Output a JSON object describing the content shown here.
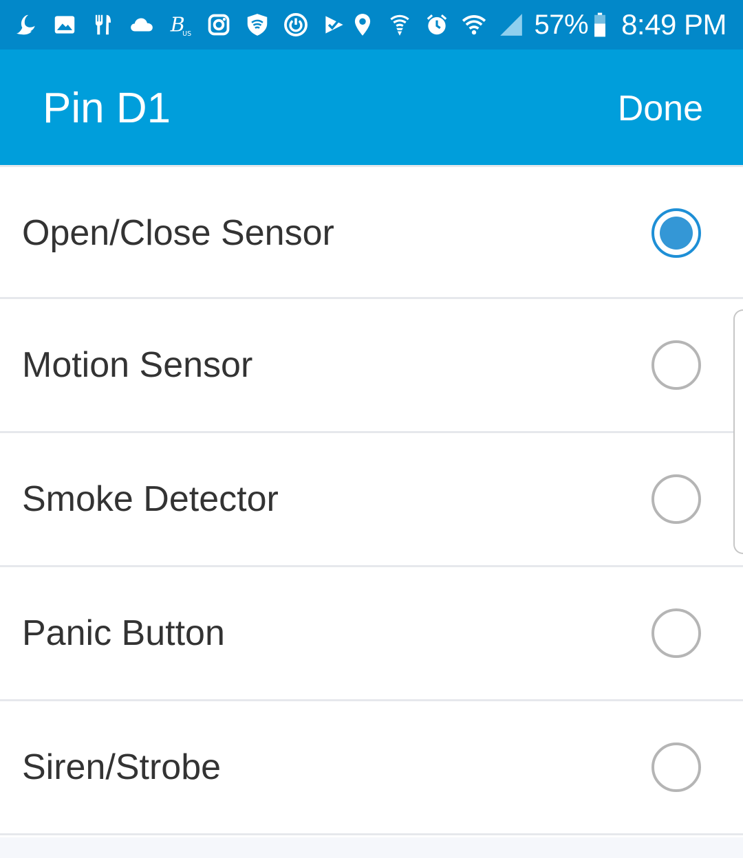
{
  "status_bar": {
    "left_icons": [
      "moon-icon",
      "image-icon",
      "restaurant-icon",
      "cloud-icon",
      "bitcoin-icon",
      "instagram-icon",
      "vpn-shield-icon",
      "power-icon",
      "checkmark-app-icon"
    ],
    "right_icons": [
      "location-icon",
      "wifi-calling-icon",
      "alarm-icon",
      "wifi-icon",
      "signal-icon",
      "battery-icon"
    ],
    "battery_percent": "57%",
    "time": "8:49 PM",
    "background_color": "#0288c9"
  },
  "app_bar": {
    "title": "Pin D1",
    "done_label": "Done",
    "background_color": "#009edb"
  },
  "options": [
    {
      "label": "Open/Close Sensor",
      "selected": true
    },
    {
      "label": "Motion Sensor",
      "selected": false
    },
    {
      "label": "Smoke Detector",
      "selected": false
    },
    {
      "label": "Panic Button",
      "selected": false
    },
    {
      "label": "Siren/Strobe",
      "selected": false
    }
  ],
  "colors": {
    "accent": "#3497d6",
    "radio_unselected": "#b5b5b5",
    "text": "#333333"
  }
}
